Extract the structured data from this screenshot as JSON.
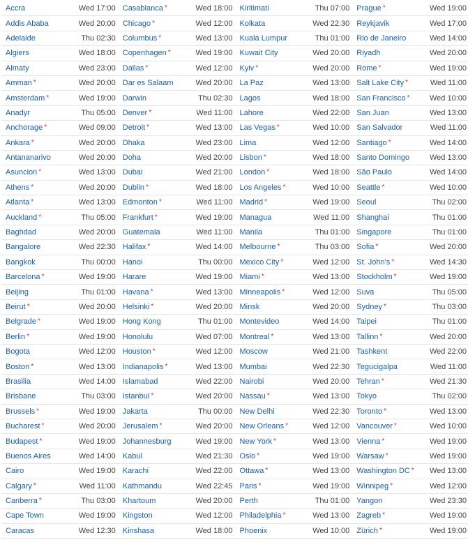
{
  "columns": [
    [
      {
        "city": "Accra",
        "time": "Wed 17:00",
        "star": false
      },
      {
        "city": "Addis Ababa",
        "time": "Wed 20:00",
        "star": false
      },
      {
        "city": "Adelaide",
        "time": "Thu 02:30",
        "star": false
      },
      {
        "city": "Algiers",
        "time": "Wed 18:00",
        "star": false
      },
      {
        "city": "Almaty",
        "time": "Wed 23:00",
        "star": false
      },
      {
        "city": "Amman",
        "time": "Wed 20:00",
        "star": true
      },
      {
        "city": "Amsterdam",
        "time": "Wed 19:00",
        "star": true
      },
      {
        "city": "Anadyr",
        "time": "Thu 05:00",
        "star": false
      },
      {
        "city": "Anchorage",
        "time": "Wed 09:00",
        "star": true
      },
      {
        "city": "Ankara",
        "time": "Wed 20:00",
        "star": true
      },
      {
        "city": "Antananarivo",
        "time": "Wed 20:00",
        "star": false
      },
      {
        "city": "Asuncion",
        "time": "Wed 13:00",
        "star": true
      },
      {
        "city": "Athens",
        "time": "Wed 20:00",
        "star": true
      },
      {
        "city": "Atlanta",
        "time": "Wed 13:00",
        "star": true
      },
      {
        "city": "Auckland",
        "time": "Thu 05:00",
        "star": true
      },
      {
        "city": "Baghdad",
        "time": "Wed 20:00",
        "star": false
      },
      {
        "city": "Bangalore",
        "time": "Wed 22:30",
        "star": false
      },
      {
        "city": "Bangkok",
        "time": "Thu 00:00",
        "star": false
      },
      {
        "city": "Barcelona",
        "time": "Wed 19:00",
        "star": true
      },
      {
        "city": "Beijing",
        "time": "Thu 01:00",
        "star": false
      },
      {
        "city": "Beirut",
        "time": "Wed 20:00",
        "star": true
      },
      {
        "city": "Belgrade",
        "time": "Wed 19:00",
        "star": true
      },
      {
        "city": "Berlin",
        "time": "Wed 19:00",
        "star": true
      },
      {
        "city": "Bogota",
        "time": "Wed 12:00",
        "star": false
      },
      {
        "city": "Boston",
        "time": "Wed 13:00",
        "star": true
      },
      {
        "city": "Brasilia",
        "time": "Wed 14:00",
        "star": false
      },
      {
        "city": "Brisbane",
        "time": "Thu 03:00",
        "star": false
      },
      {
        "city": "Brussels",
        "time": "Wed 19:00",
        "star": true
      },
      {
        "city": "Bucharest",
        "time": "Wed 20:00",
        "star": true
      },
      {
        "city": "Budapest",
        "time": "Wed 19:00",
        "star": true
      },
      {
        "city": "Buenos Aires",
        "time": "Wed 14:00",
        "star": false
      },
      {
        "city": "Cairo",
        "time": "Wed 19:00",
        "star": false
      },
      {
        "city": "Calgary",
        "time": "Wed 11:00",
        "star": true
      },
      {
        "city": "Canberra",
        "time": "Thu 03:00",
        "star": true
      },
      {
        "city": "Cape Town",
        "time": "Wed 19:00",
        "star": false
      },
      {
        "city": "Caracas",
        "time": "Wed 12:30",
        "star": false
      }
    ],
    [
      {
        "city": "Casablanca",
        "time": "Wed 18:00",
        "star": true
      },
      {
        "city": "Chicago",
        "time": "Wed 12:00",
        "star": true
      },
      {
        "city": "Columbus",
        "time": "Wed 13:00",
        "star": true
      },
      {
        "city": "Copenhagen",
        "time": "Wed 19:00",
        "star": true
      },
      {
        "city": "Dallas",
        "time": "Wed 12:00",
        "star": true
      },
      {
        "city": "Dar es Salaam",
        "time": "Wed 20:00",
        "star": false
      },
      {
        "city": "Darwin",
        "time": "Thu 02:30",
        "star": false
      },
      {
        "city": "Denver",
        "time": "Wed 11:00",
        "star": true
      },
      {
        "city": "Detroit",
        "time": "Wed 13:00",
        "star": true
      },
      {
        "city": "Dhaka",
        "time": "Wed 23:00",
        "star": false
      },
      {
        "city": "Doha",
        "time": "Wed 20:00",
        "star": false
      },
      {
        "city": "Dubai",
        "time": "Wed 21:00",
        "star": false
      },
      {
        "city": "Dublin",
        "time": "Wed 18:00",
        "star": true
      },
      {
        "city": "Edmonton",
        "time": "Wed 11:00",
        "star": true
      },
      {
        "city": "Frankfurt",
        "time": "Wed 19:00",
        "star": true
      },
      {
        "city": "Guatemala",
        "time": "Wed 11:00",
        "star": false
      },
      {
        "city": "Halifax",
        "time": "Wed 14:00",
        "star": true
      },
      {
        "city": "Hanoi",
        "time": "Thu 00:00",
        "star": false
      },
      {
        "city": "Harare",
        "time": "Wed 19:00",
        "star": false
      },
      {
        "city": "Havana",
        "time": "Wed 13:00",
        "star": true
      },
      {
        "city": "Helsinki",
        "time": "Wed 20:00",
        "star": true
      },
      {
        "city": "Hong Kong",
        "time": "Thu 01:00",
        "star": false
      },
      {
        "city": "Honolulu",
        "time": "Wed 07:00",
        "star": false
      },
      {
        "city": "Houston",
        "time": "Wed 12:00",
        "star": true
      },
      {
        "city": "Indianapolis",
        "time": "Wed 13:00",
        "star": true
      },
      {
        "city": "Islamabad",
        "time": "Wed 22:00",
        "star": false
      },
      {
        "city": "Istanbul",
        "time": "Wed 20:00",
        "star": true
      },
      {
        "city": "Jakarta",
        "time": "Thu 00:00",
        "star": false
      },
      {
        "city": "Jerusalem",
        "time": "Wed 20:00",
        "star": true
      },
      {
        "city": "Johannesburg",
        "time": "Wed 19:00",
        "star": false
      },
      {
        "city": "Kabul",
        "time": "Wed 21:30",
        "star": false
      },
      {
        "city": "Karachi",
        "time": "Wed 22:00",
        "star": false
      },
      {
        "city": "Kathmandu",
        "time": "Wed 22:45",
        "star": false
      },
      {
        "city": "Khartoum",
        "time": "Wed 20:00",
        "star": false
      },
      {
        "city": "Kingston",
        "time": "Wed 12:00",
        "star": false
      },
      {
        "city": "Kinshasa",
        "time": "Wed 18:00",
        "star": false
      }
    ],
    [
      {
        "city": "Kiritimati",
        "time": "Thu 07:00",
        "star": false
      },
      {
        "city": "Kolkata",
        "time": "Wed 22:30",
        "star": false
      },
      {
        "city": "Kuala Lumpur",
        "time": "Thu 01:00",
        "star": false
      },
      {
        "city": "Kuwait City",
        "time": "Wed 20:00",
        "star": false
      },
      {
        "city": "Kyiv",
        "time": "Wed 20:00",
        "star": true
      },
      {
        "city": "La Paz",
        "time": "Wed 13:00",
        "star": false
      },
      {
        "city": "Lagos",
        "time": "Wed 18:00",
        "star": false
      },
      {
        "city": "Lahore",
        "time": "Wed 22:00",
        "star": false
      },
      {
        "city": "Las Vegas",
        "time": "Wed 10:00",
        "star": true
      },
      {
        "city": "Lima",
        "time": "Wed 12:00",
        "star": false
      },
      {
        "city": "Lisbon",
        "time": "Wed 18:00",
        "star": true
      },
      {
        "city": "London",
        "time": "Wed 18:00",
        "star": true
      },
      {
        "city": "Los Angeles",
        "time": "Wed 10:00",
        "star": true
      },
      {
        "city": "Madrid",
        "time": "Wed 19:00",
        "star": true
      },
      {
        "city": "Managua",
        "time": "Wed 11:00",
        "star": false
      },
      {
        "city": "Manila",
        "time": "Thu 01:00",
        "star": false
      },
      {
        "city": "Melbourne",
        "time": "Thu 03:00",
        "star": true
      },
      {
        "city": "Mexico City",
        "time": "Wed 12:00",
        "star": true
      },
      {
        "city": "Miami",
        "time": "Wed 13:00",
        "star": true
      },
      {
        "city": "Minneapolis",
        "time": "Wed 12:00",
        "star": true
      },
      {
        "city": "Minsk",
        "time": "Wed 20:00",
        "star": false
      },
      {
        "city": "Montevideo",
        "time": "Wed 14:00",
        "star": false
      },
      {
        "city": "Montreal",
        "time": "Wed 13:00",
        "star": true
      },
      {
        "city": "Moscow",
        "time": "Wed 21:00",
        "star": false
      },
      {
        "city": "Mumbai",
        "time": "Wed 22:30",
        "star": false
      },
      {
        "city": "Nairobi",
        "time": "Wed 20:00",
        "star": false
      },
      {
        "city": "Nassau",
        "time": "Wed 13:00",
        "star": true
      },
      {
        "city": "New Delhi",
        "time": "Wed 22:30",
        "star": false
      },
      {
        "city": "New Orleans",
        "time": "Wed 12:00",
        "star": true
      },
      {
        "city": "New York",
        "time": "Wed 13:00",
        "star": true
      },
      {
        "city": "Oslo",
        "time": "Wed 19:00",
        "star": true
      },
      {
        "city": "Ottawa",
        "time": "Wed 13:00",
        "star": true
      },
      {
        "city": "Paris",
        "time": "Wed 19:00",
        "star": true
      },
      {
        "city": "Perth",
        "time": "Thu 01:00",
        "star": false
      },
      {
        "city": "Philadelphia",
        "time": "Wed 13:00",
        "star": true
      },
      {
        "city": "Phoenix",
        "time": "Wed 10:00",
        "star": false
      }
    ],
    [
      {
        "city": "Prague",
        "time": "Wed 19:00",
        "star": true
      },
      {
        "city": "Reykjavik",
        "time": "Wed 17:00",
        "star": false
      },
      {
        "city": "Rio de Janeiro",
        "time": "Wed 14:00",
        "star": false
      },
      {
        "city": "Riyadh",
        "time": "Wed 20:00",
        "star": false
      },
      {
        "city": "Rome",
        "time": "Wed 19:00",
        "star": true
      },
      {
        "city": "Salt Lake City",
        "time": "Wed 11:00",
        "star": true
      },
      {
        "city": "San Francisco",
        "time": "Wed 10:00",
        "star": true
      },
      {
        "city": "San Juan",
        "time": "Wed 13:00",
        "star": false
      },
      {
        "city": "San Salvador",
        "time": "Wed 11:00",
        "star": false
      },
      {
        "city": "Santiago",
        "time": "Wed 14:00",
        "star": true
      },
      {
        "city": "Santo Domingo",
        "time": "Wed 13:00",
        "star": false
      },
      {
        "city": "São Paulo",
        "time": "Wed 14:00",
        "star": false
      },
      {
        "city": "Seattle",
        "time": "Wed 10:00",
        "star": true
      },
      {
        "city": "Seoul",
        "time": "Thu 02:00",
        "star": false
      },
      {
        "city": "Shanghai",
        "time": "Thu 01:00",
        "star": false
      },
      {
        "city": "Singapore",
        "time": "Thu 01:00",
        "star": false
      },
      {
        "city": "Sofia",
        "time": "Wed 20:00",
        "star": true
      },
      {
        "city": "St. John's",
        "time": "Wed 14:30",
        "star": true
      },
      {
        "city": "Stockholm",
        "time": "Wed 19:00",
        "star": true
      },
      {
        "city": "Suva",
        "time": "Thu 05:00",
        "star": false
      },
      {
        "city": "Sydney",
        "time": "Thu 03:00",
        "star": true
      },
      {
        "city": "Taipei",
        "time": "Thu 01:00",
        "star": false
      },
      {
        "city": "Tallinn",
        "time": "Wed 20:00",
        "star": true
      },
      {
        "city": "Tashkent",
        "time": "Wed 22:00",
        "star": false
      },
      {
        "city": "Tegucigalpa",
        "time": "Wed 11:00",
        "star": false
      },
      {
        "city": "Tehran",
        "time": "Wed 21:30",
        "star": true
      },
      {
        "city": "Tokyo",
        "time": "Thu 02:00",
        "star": false
      },
      {
        "city": "Toronto",
        "time": "Wed 13:00",
        "star": true
      },
      {
        "city": "Vancouver",
        "time": "Wed 10:00",
        "star": true
      },
      {
        "city": "Vienna",
        "time": "Wed 19:00",
        "star": true
      },
      {
        "city": "Warsaw",
        "time": "Wed 19:00",
        "star": true
      },
      {
        "city": "Washington DC",
        "time": "Wed 13:00",
        "star": true
      },
      {
        "city": "Winnipeg",
        "time": "Wed 12:00",
        "star": true
      },
      {
        "city": "Yangon",
        "time": "Wed 23:30",
        "star": false
      },
      {
        "city": "Zagreb",
        "time": "Wed 19:00",
        "star": true
      },
      {
        "city": "Zürich",
        "time": "Wed 19:00",
        "star": true
      }
    ]
  ]
}
